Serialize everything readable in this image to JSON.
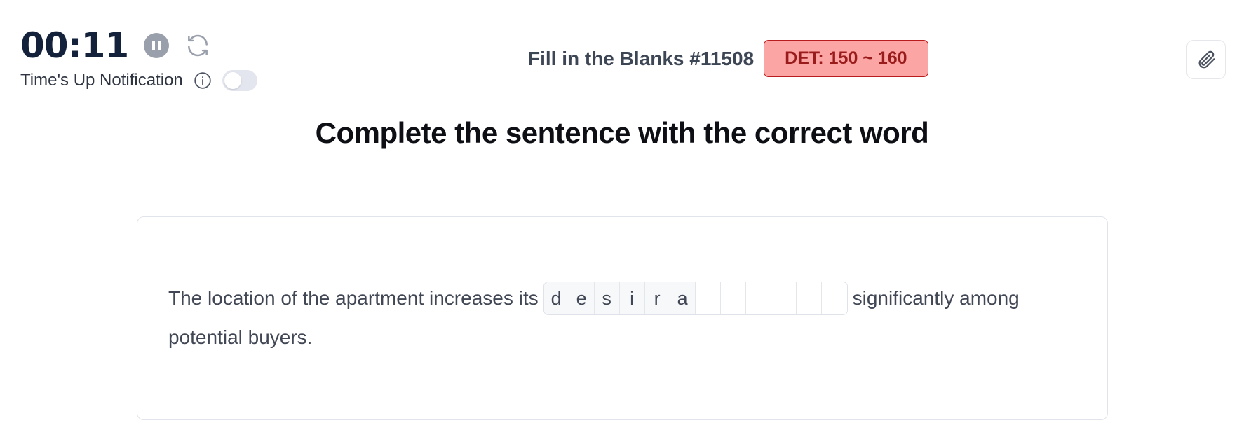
{
  "timer": {
    "time": "00:11",
    "pause_icon": "pause-icon",
    "refresh_icon": "refresh-icon"
  },
  "notification": {
    "label": "Time's Up Notification",
    "info_icon": "info-icon",
    "enabled": false
  },
  "header": {
    "question_title": "Fill in the Blanks #11508",
    "det_badge": "DET: 150 ~ 160",
    "attach_icon": "paperclip-icon"
  },
  "instruction": "Complete the sentence with the correct word",
  "question": {
    "before": "The location of the apartment increases its",
    "filled_letters": [
      "d",
      "e",
      "s",
      "i",
      "r",
      "a"
    ],
    "total_cells": 12,
    "after_line1": "significantly among",
    "line2": "potential buyers."
  },
  "colors": {
    "badge_bg": "#fca5a5",
    "badge_border": "#b91c1c",
    "badge_text": "#991b1b",
    "timer_text": "#13213b"
  }
}
